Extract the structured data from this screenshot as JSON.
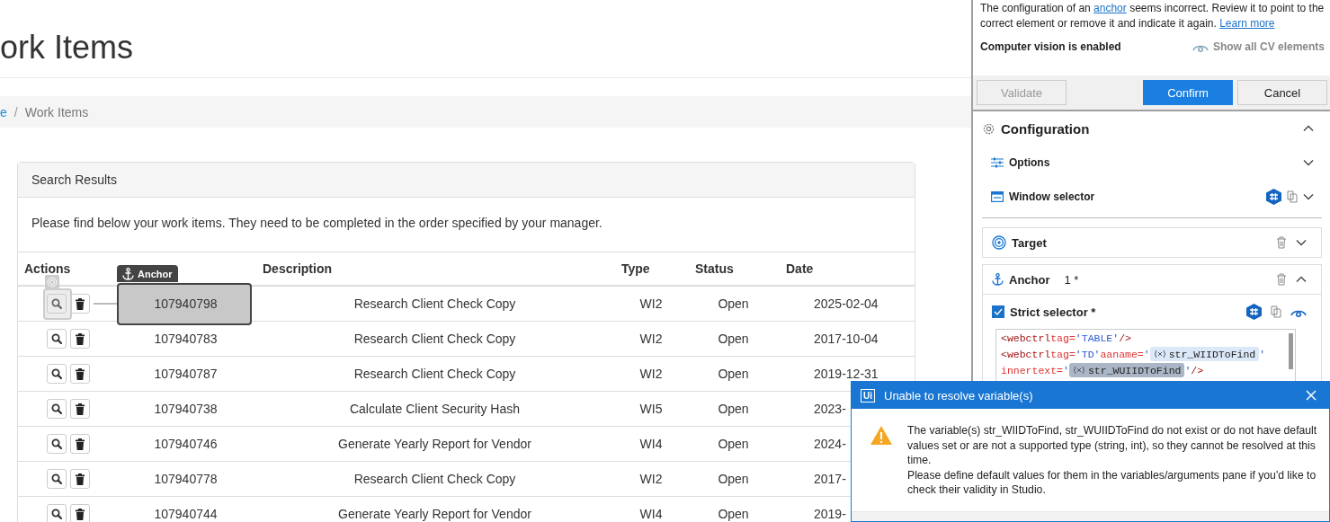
{
  "page": {
    "title": "ork Items",
    "breadcrumb_separator": "/",
    "breadcrumb": [
      {
        "label": "e",
        "link": true
      },
      {
        "label": "Work Items",
        "link": false
      }
    ]
  },
  "results": {
    "header": "Search Results",
    "intro": "Please find below your work items. They need to be completed in the order specified by your manager.",
    "columns": [
      "Actions",
      null,
      "Description",
      "Type",
      "Status",
      "Date"
    ],
    "anchor_label": "Anchor",
    "rows": [
      {
        "id": "107940798",
        "description": "Research Client Check Copy",
        "type": "WI2",
        "status": "Open",
        "date": "2025-02-04",
        "anchor": true,
        "target": true
      },
      {
        "id": "107940783",
        "description": "Research Client Check Copy",
        "type": "WI2",
        "status": "Open",
        "date": "2017-10-04",
        "anchor": false,
        "target": false
      },
      {
        "id": "107940787",
        "description": "Research Client Check Copy",
        "type": "WI2",
        "status": "Open",
        "date": "2019-12-31",
        "anchor": false,
        "target": false
      },
      {
        "id": "107940738",
        "description": "Calculate Client Security Hash",
        "type": "WI5",
        "status": "Open",
        "date": "2023-",
        "anchor": false,
        "target": false
      },
      {
        "id": "107940746",
        "description": "Generate Yearly Report for Vendor",
        "type": "WI4",
        "status": "Open",
        "date": "2024-",
        "anchor": false,
        "target": false
      },
      {
        "id": "107940778",
        "description": "Research Client Check Copy",
        "type": "WI2",
        "status": "Open",
        "date": "2017-",
        "anchor": false,
        "target": false
      },
      {
        "id": "107940744",
        "description": "Generate Yearly Report for Vendor",
        "type": "WI4",
        "status": "Open",
        "date": "2019-",
        "anchor": false,
        "target": false
      }
    ]
  },
  "panel": {
    "message": [
      {
        "text": "The configuration of an ",
        "link": false
      },
      {
        "text": "anchor",
        "link": true
      },
      {
        "text": " seems incorrect. Review it to point to the correct element or remove it and indicate it again. ",
        "link": false
      },
      {
        "text": "Learn more",
        "link": true
      }
    ],
    "cv_status": "Computer vision is enabled",
    "cv_link": "Show all CV elements",
    "buttons": [
      {
        "label": "Validate",
        "kind": "plain",
        "disabled": true
      },
      {
        "label": "Confirm",
        "kind": "primary",
        "disabled": false
      },
      {
        "label": "Cancel",
        "kind": "plain",
        "disabled": false
      }
    ],
    "configuration": {
      "title": "Configuration",
      "expanded": true,
      "items": [
        {
          "label": "Options",
          "kind": "options",
          "expanded": false
        },
        {
          "label": "Window selector",
          "kind": "window",
          "expanded": false
        }
      ]
    },
    "target": {
      "label": "Target",
      "expanded": false
    },
    "anchor": {
      "label": "Anchor",
      "count": "1 *",
      "expanded": true,
      "strict_label": "Strict selector *",
      "strict_checked": true,
      "code": [
        [
          {
            "kind": "tag",
            "text": "<webctrl"
          },
          {
            "kind": "attr",
            "text": "tag="
          },
          {
            "kind": "value",
            "text": "'TABLE'"
          },
          {
            "kind": "tag",
            "text": "/>"
          }
        ],
        [
          {
            "kind": "tag",
            "text": "<webctrl"
          },
          {
            "kind": "attr",
            "text": "tag="
          },
          {
            "kind": "value",
            "text": "'TD'"
          },
          {
            "kind": "attr",
            "text": "aaname="
          },
          {
            "kind": "value",
            "text": "'"
          },
          {
            "kind": "variable",
            "text": "str_WIIDToFind",
            "selected": false
          },
          {
            "kind": "value",
            "text": "'"
          }
        ],
        [
          {
            "kind": "attr",
            "text": "innertext="
          },
          {
            "kind": "value",
            "text": "'"
          },
          {
            "kind": "variable",
            "text": "str_WUIIDToFind",
            "selected": true
          },
          {
            "kind": "value",
            "text": "'"
          },
          {
            "kind": "tag",
            "text": "/>"
          }
        ]
      ]
    }
  },
  "dialog": {
    "title": "Unable to resolve variable(s)",
    "logo": "Ui",
    "paragraphs": [
      "The variable(s) str_WIIDToFind, str_WUIIDToFind do not exist or do not have default values set or are not a supported type (string, int), so they cannot be resolved at this time.",
      "Please define default values for them in the variables/arguments pane if you'd like to check their validity in Studio."
    ]
  }
}
